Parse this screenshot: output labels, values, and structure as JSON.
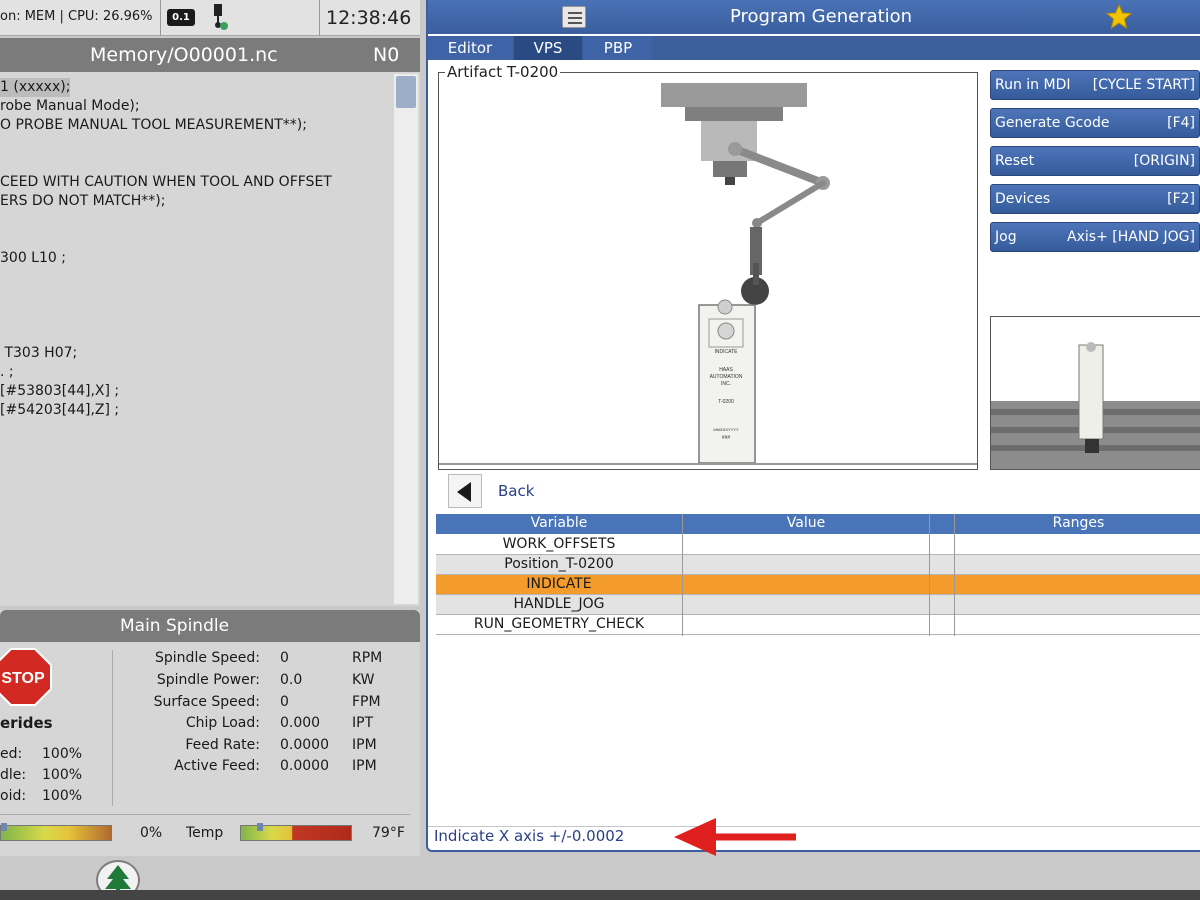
{
  "status_bar": {
    "text": "on: MEM | CPU: 26.96%",
    "disk_icon_text": "0.1",
    "time": "12:38:46"
  },
  "program": {
    "title": "Memory/O00001.nc",
    "line_number": "N0",
    "lines": [
      "1 (xxxxx);",
      "robe Manual Mode);",
      "O PROBE MANUAL TOOL MEASUREMENT**);",
      "",
      "",
      "CEED WITH CAUTION WHEN TOOL AND OFFSET",
      "ERS DO NOT MATCH**);",
      "",
      "",
      "300 L10 ;",
      "",
      "",
      "",
      "",
      " T303 H07;",
      ". ;",
      "[#53803[44],X] ;",
      "[#54203[44],Z] ;"
    ]
  },
  "spindle": {
    "title": "Main Spindle",
    "stop_label": "STOP",
    "overrides_label": "erides",
    "overrides": [
      {
        "label": "ed:",
        "value": "100%"
      },
      {
        "label": "dle:",
        "value": "100%"
      },
      {
        "label": "oid:",
        "value": "100%"
      }
    ],
    "readouts": [
      {
        "label": "Spindle Speed:",
        "value": "0",
        "unit": "RPM"
      },
      {
        "label": "Spindle Power:",
        "value": "0.0",
        "unit": "KW"
      },
      {
        "label": "Surface Speed:",
        "value": "0",
        "unit": "FPM"
      },
      {
        "label": "Chip Load:",
        "value": "0.000",
        "unit": "IPT"
      },
      {
        "label": "Feed Rate:",
        "value": "0.0000",
        "unit": "IPM"
      },
      {
        "label": "Active Feed:",
        "value": "0.0000",
        "unit": "IPM"
      }
    ],
    "load_percent": "0%",
    "temp_label": "Temp",
    "temp_value": "79°F"
  },
  "right_panel": {
    "title": "Program Generation",
    "tabs": [
      "Editor",
      "VPS",
      "PBP"
    ],
    "active_tab": "VPS",
    "artifact_title": "Artifact T-0200",
    "artifact_labels": {
      "indicate": "INDICATE",
      "company": "HAAS",
      "company2": "AUTOMATION",
      "company3": "INC.",
      "part": "T-0200",
      "date": "MM/DD/YYYY",
      "serial": "###"
    },
    "buttons": [
      {
        "label": "Run in MDI",
        "key": "[CYCLE START]"
      },
      {
        "label": "Generate Gcode",
        "key": "[F4]"
      },
      {
        "label": "Reset",
        "key": "[ORIGIN]"
      },
      {
        "label": "Devices",
        "key": "[F2]"
      },
      {
        "label": "Jog",
        "key": "Axis+ [HAND JOG]"
      }
    ],
    "back_label": "Back",
    "table": {
      "headers": [
        "Variable",
        "Value",
        "",
        "Ranges"
      ],
      "rows": [
        "WORK_OFFSETS",
        "Position_T-0200",
        "INDICATE",
        "HANDLE_JOG",
        "RUN_GEOMETRY_CHECK"
      ],
      "selected_row": 2
    },
    "status_message": "Indicate X axis +/-0.0002"
  },
  "colors": {
    "accent_blue": "#3a5e9e",
    "selected_row": "#f39b2b",
    "annotation_arrow": "#e01f1f"
  },
  "icons": {
    "disk": "disk-icon",
    "probe": "probe-icon",
    "menu": "hamburger-menu-icon",
    "star": "star-icon",
    "back": "back-arrow-icon",
    "stop": "stop-sign-icon",
    "tree": "tree-icon",
    "annotation": "red-arrow-icon"
  }
}
